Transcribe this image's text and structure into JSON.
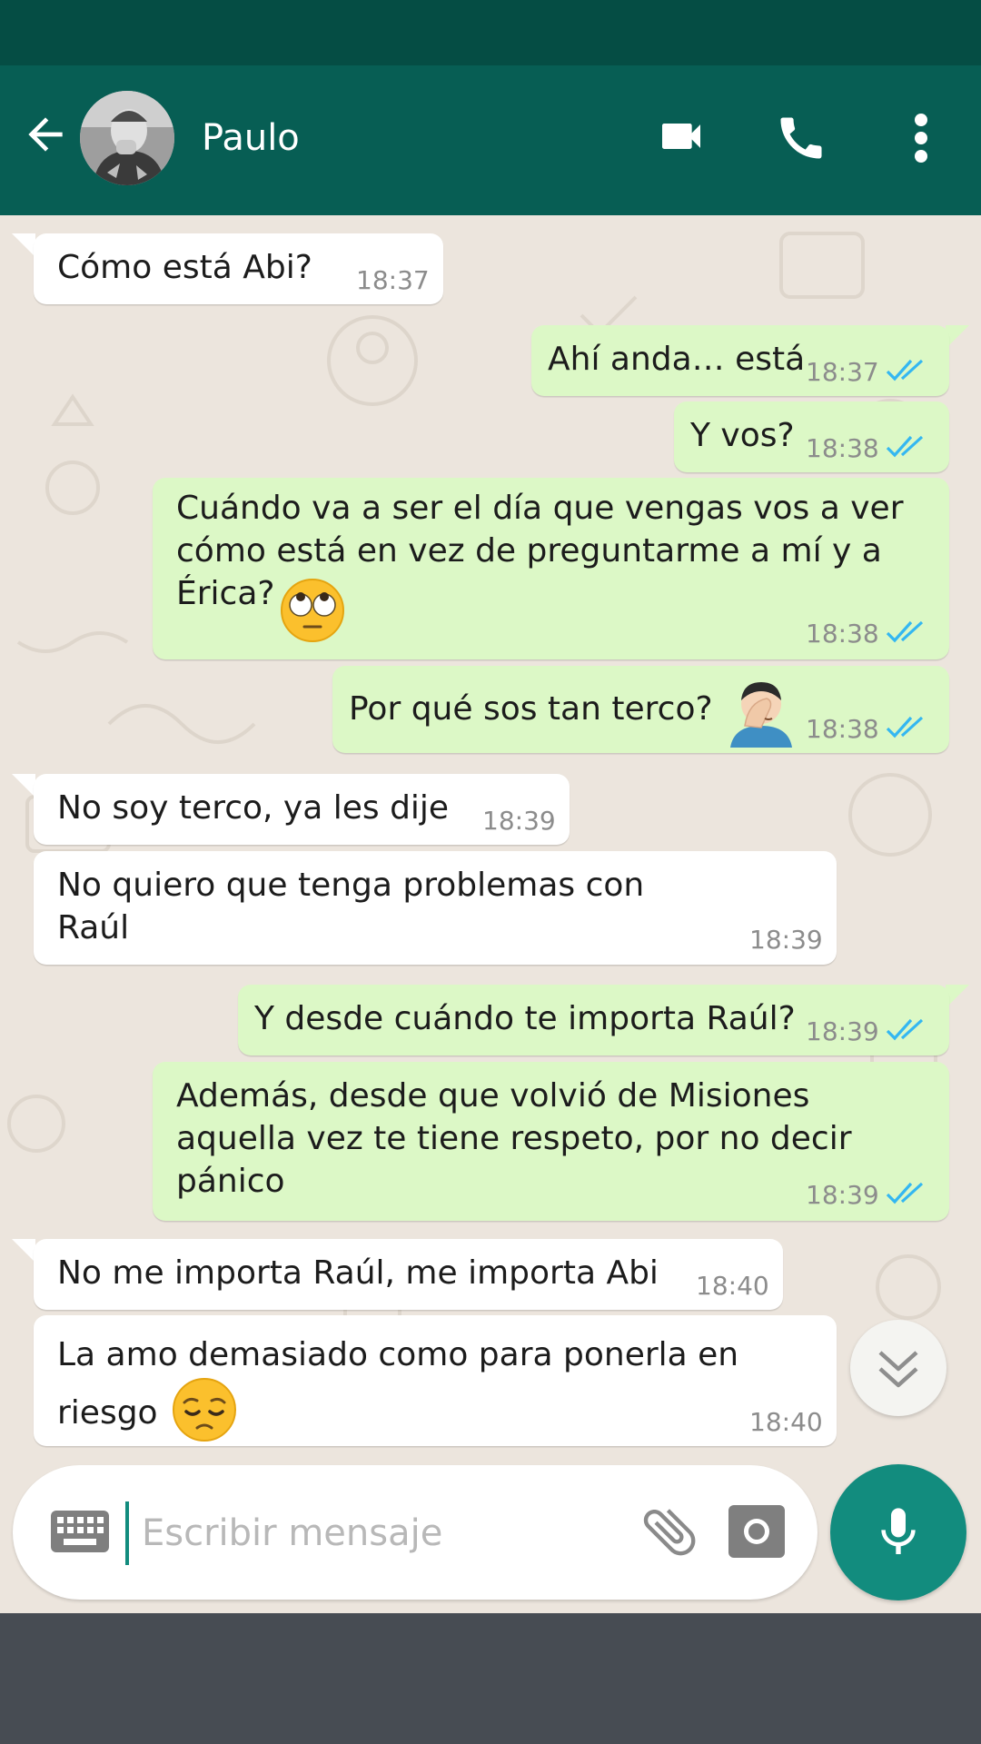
{
  "header": {
    "contact_name": "Paulo",
    "back_icon": "arrow-left-icon",
    "video_icon": "videocam-icon",
    "call_icon": "phone-icon",
    "menu_icon": "more-vert-icon"
  },
  "colors": {
    "status_bar": "#054d44",
    "header": "#075e54",
    "outgoing_bubble": "#dcf8c6",
    "incoming_bubble": "#ffffff",
    "read_ticks": "#34b7f1",
    "accent": "#128c7e",
    "nav_bar": "#474c53"
  },
  "messages": [
    {
      "direction": "in",
      "text": "Cómo está Abi?",
      "time": "18:37"
    },
    {
      "direction": "out",
      "text": "Ahí anda… está",
      "time": "18:37",
      "status": "read"
    },
    {
      "direction": "out",
      "text": "Y vos?",
      "time": "18:38",
      "status": "read"
    },
    {
      "direction": "out",
      "text": "Cuándo va a ser el día que vengas vos a ver\ncómo está en vez de preguntarme a mí y a\nÉrica?",
      "emoji": "face-with-rolling-eyes",
      "time": "18:38",
      "status": "read"
    },
    {
      "direction": "out",
      "text": "Por qué sos tan terco?",
      "emoji": "man-facepalming",
      "time": "18:38",
      "status": "read"
    },
    {
      "direction": "in",
      "text": "No soy terco, ya les dije",
      "time": "18:39"
    },
    {
      "direction": "in",
      "text": "No quiero que tenga problemas con\nRaúl",
      "time": "18:39"
    },
    {
      "direction": "out",
      "text": "Y desde cuándo te importa Raúl?",
      "time": "18:39",
      "status": "read"
    },
    {
      "direction": "out",
      "text": "Además, desde que volvió de Misiones\naquella vez te tiene respeto, por no decir\npánico",
      "time": "18:39",
      "status": "read"
    },
    {
      "direction": "in",
      "text": "No me importa Raúl, me importa Abi",
      "time": "18:40"
    },
    {
      "direction": "in",
      "text": "La amo demasiado como para ponerla en\nriesgo",
      "emoji": "pensive-face",
      "time": "18:40"
    }
  ],
  "composer": {
    "placeholder": "Escribir mensaje",
    "keyboard_icon": "keyboard-icon",
    "attach_icon": "paperclip-icon",
    "camera_icon": "camera-icon",
    "mic_icon": "microphone-icon",
    "scroll_icon": "chevron-double-down-icon"
  }
}
